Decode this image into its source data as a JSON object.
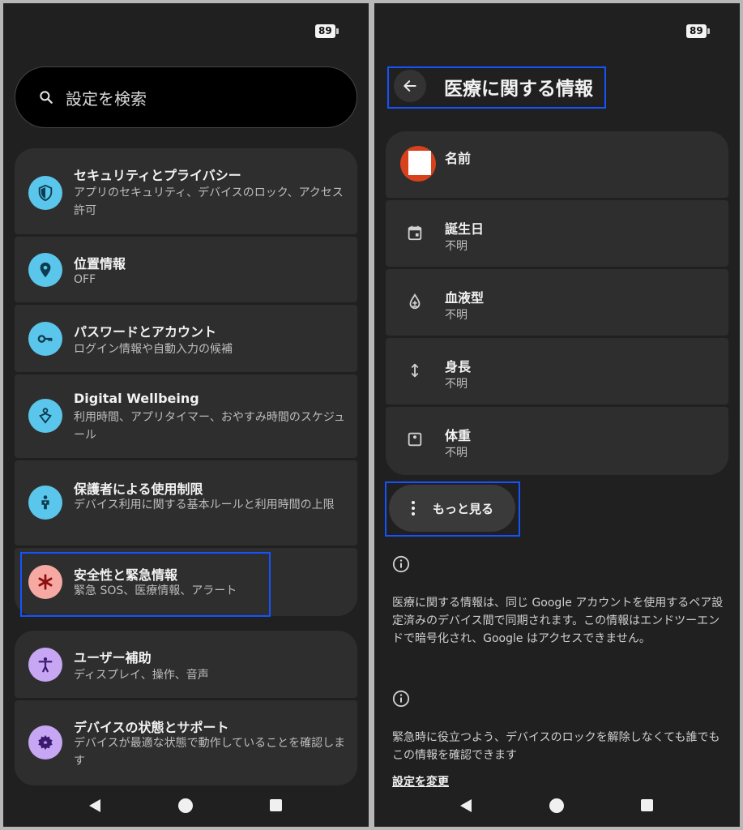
{
  "status_bar": {
    "battery_left": "89",
    "battery_right": "89"
  },
  "settings": {
    "search_placeholder": "設定を検索",
    "items": [
      {
        "title": "セキュリティとプライバシー",
        "subtitle": "アプリのセキュリティ、デバイスのロック、アクセス許可",
        "icon": "shield-icon"
      },
      {
        "title": "位置情報",
        "subtitle": "OFF",
        "icon": "location-pin-icon"
      },
      {
        "title": "パスワードとアカウント",
        "subtitle": "ログイン情報や自動入力の候補",
        "icon": "key-icon"
      },
      {
        "title": "Digital Wellbeing",
        "subtitle": "利用時間、アプリタイマー、おやすみ時間のスケジュール",
        "icon": "wellbeing-icon"
      },
      {
        "title": "保護者による使用制限",
        "subtitle": "デバイス利用に関する基本ルールと利用時間の上限",
        "icon": "family-icon"
      },
      {
        "title": "安全性と緊急情報",
        "subtitle": "緊急 SOS、医療情報、アラート",
        "icon": "asterisk-icon"
      },
      {
        "title": "ユーザー補助",
        "subtitle": "ディスプレイ、操作、音声",
        "icon": "accessibility-icon"
      },
      {
        "title": "デバイスの状態とサポート",
        "subtitle": "デバイスが最適な状態で動作していることを確認します",
        "icon": "gear-icon"
      }
    ]
  },
  "medical": {
    "title": "医療に関する情報",
    "rows": [
      {
        "label": "名前",
        "value": ""
      },
      {
        "label": "誕生日",
        "value": "不明"
      },
      {
        "label": "血液型",
        "value": "不明"
      },
      {
        "label": "身長",
        "value": "不明"
      },
      {
        "label": "体重",
        "value": "不明"
      }
    ],
    "more_button": "もっと見る",
    "info1": "医療に関する情報は、同じ Google アカウントを使用するペア設定済みのデバイス間で同期されます。この情報はエンドツーエンドで暗号化され、Google はアクセスできません。",
    "info2": "緊急時に役立つよう、デバイスのロックを解除しなくても誰でもこの情報を確認できます",
    "change_link": "設定を変更"
  },
  "colors": {
    "accent_blue": "#5ac6ec",
    "highlight": "#1453ff",
    "sos_pink": "#f5a9a2",
    "purple": "#c7a6f3",
    "avatar": "#d9401c"
  }
}
